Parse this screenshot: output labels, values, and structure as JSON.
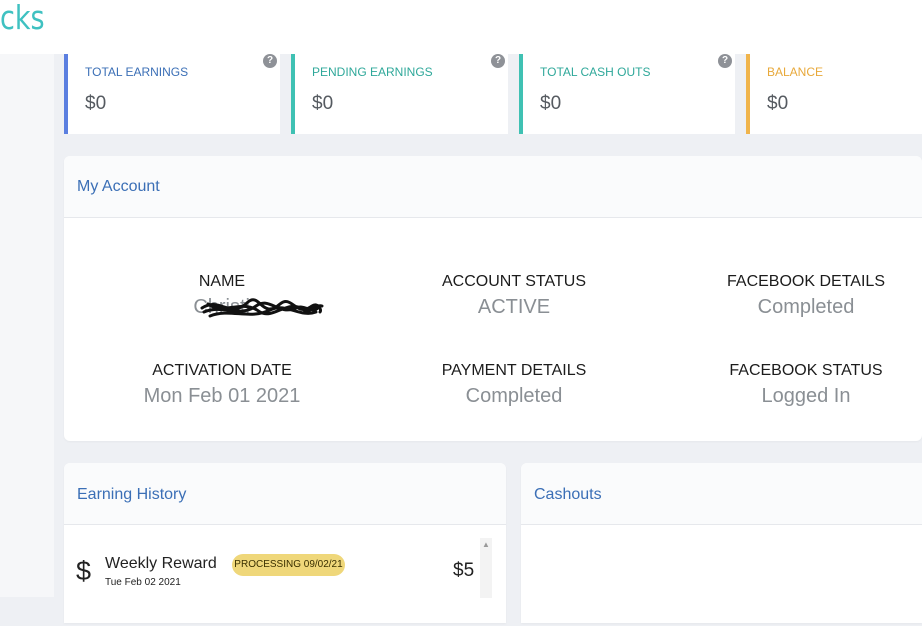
{
  "header": {
    "logo_text": "cks"
  },
  "stats": [
    {
      "label": "TOTAL EARNINGS",
      "value": "$0",
      "color": "#5b7fe0",
      "help": "?"
    },
    {
      "label": "PENDING EARNINGS",
      "value": "$0",
      "color": "#3fc1b3",
      "help": "?"
    },
    {
      "label": "TOTAL CASH OUTS",
      "value": "$0",
      "color": "#3fc1b3",
      "help": "?"
    },
    {
      "label": "BALANCE",
      "value": "$0",
      "color": "#f0b44b"
    }
  ],
  "account": {
    "title": "My Account",
    "fields": [
      {
        "label": "NAME",
        "value": "Christi"
      },
      {
        "label": "ACCOUNT STATUS",
        "value": "ACTIVE"
      },
      {
        "label": "FACEBOOK DETAILS",
        "value": "Completed"
      },
      {
        "label": "ACTIVATION DATE",
        "value": "Mon Feb 01 2021"
      },
      {
        "label": "PAYMENT DETAILS",
        "value": "Completed"
      },
      {
        "label": "FACEBOOK STATUS",
        "value": "Logged In"
      }
    ]
  },
  "earning_history": {
    "title": "Earning History",
    "items": [
      {
        "icon": "dollar-icon",
        "title": "Weekly Reward",
        "date": "Tue Feb 02 2021",
        "badge": "PROCESSING 09/02/21",
        "amount": "$5"
      }
    ]
  },
  "cashouts": {
    "title": "Cashouts"
  }
}
